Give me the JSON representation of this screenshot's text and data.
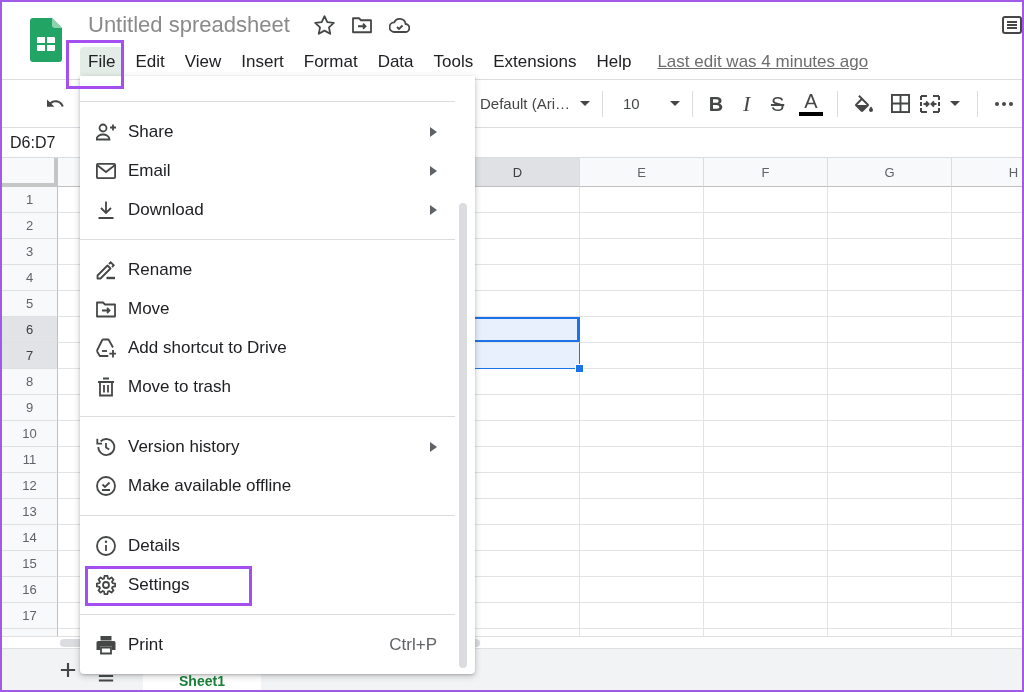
{
  "header": {
    "title": "Untitled spreadsheet"
  },
  "menu_bar": {
    "items": [
      {
        "label": "File",
        "selected": true,
        "highlighted": true
      },
      {
        "label": "Edit",
        "selected": false,
        "highlighted": false
      },
      {
        "label": "View",
        "selected": false,
        "highlighted": false
      },
      {
        "label": "Insert",
        "selected": false,
        "highlighted": false
      },
      {
        "label": "Format",
        "selected": false,
        "highlighted": false
      },
      {
        "label": "Data",
        "selected": false,
        "highlighted": false
      },
      {
        "label": "Tools",
        "selected": false,
        "highlighted": false
      },
      {
        "label": "Extensions",
        "selected": false,
        "highlighted": false
      },
      {
        "label": "Help",
        "selected": false,
        "highlighted": false
      }
    ],
    "last_edit": "Last edit was 4 minutes ago"
  },
  "toolbar": {
    "font": "Default (Ari…",
    "font_size": "10",
    "format_buttons": [
      {
        "label": "B",
        "kind": "bold"
      },
      {
        "label": "I",
        "kind": "italic"
      },
      {
        "label": "S",
        "kind": "strikethrough"
      },
      {
        "label": "A",
        "kind": "text_color"
      }
    ]
  },
  "name_box": "D6:D7",
  "columns": [
    {
      "label": "D",
      "selected": true
    },
    {
      "label": "E",
      "selected": false
    },
    {
      "label": "F",
      "selected": false
    },
    {
      "label": "G",
      "selected": false
    },
    {
      "label": "H",
      "selected": false
    }
  ],
  "rows": [
    {
      "number": "1",
      "selected": false
    },
    {
      "number": "2",
      "selected": false
    },
    {
      "number": "3",
      "selected": false
    },
    {
      "number": "4",
      "selected": false
    },
    {
      "number": "5",
      "selected": false
    },
    {
      "number": "6",
      "selected": true
    },
    {
      "number": "7",
      "selected": true
    },
    {
      "number": "8",
      "selected": false
    },
    {
      "number": "9",
      "selected": false
    },
    {
      "number": "10",
      "selected": false
    },
    {
      "number": "11",
      "selected": false
    },
    {
      "number": "12",
      "selected": false
    },
    {
      "number": "13",
      "selected": false
    },
    {
      "number": "14",
      "selected": false
    },
    {
      "number": "15",
      "selected": false
    },
    {
      "number": "16",
      "selected": false
    },
    {
      "number": "17",
      "selected": false
    }
  ],
  "sheet_tabs": [
    {
      "label": "Sheet1",
      "selected": true
    }
  ],
  "file_menu": {
    "groups": [
      {
        "items": [
          {
            "label": "Share",
            "submenu": true,
            "highlighted": false
          },
          {
            "label": "Email",
            "submenu": true,
            "highlighted": false
          },
          {
            "label": "Download",
            "submenu": true,
            "highlighted": false
          }
        ]
      },
      {
        "items": [
          {
            "label": "Rename",
            "submenu": false,
            "highlighted": false
          },
          {
            "label": "Move",
            "submenu": false,
            "highlighted": false
          },
          {
            "label": "Add shortcut to Drive",
            "submenu": false,
            "highlighted": false
          },
          {
            "label": "Move to trash",
            "submenu": false,
            "highlighted": false
          }
        ]
      },
      {
        "items": [
          {
            "label": "Version history",
            "submenu": true,
            "highlighted": false
          },
          {
            "label": "Make available offline",
            "submenu": false,
            "highlighted": false
          }
        ]
      },
      {
        "items": [
          {
            "label": "Details",
            "submenu": false,
            "highlighted": false
          },
          {
            "label": "Settings",
            "submenu": false,
            "highlighted": true
          }
        ]
      },
      {
        "items": [
          {
            "label": "Print",
            "submenu": false,
            "highlighted": false,
            "shortcut": "Ctrl+P"
          }
        ]
      }
    ]
  }
}
